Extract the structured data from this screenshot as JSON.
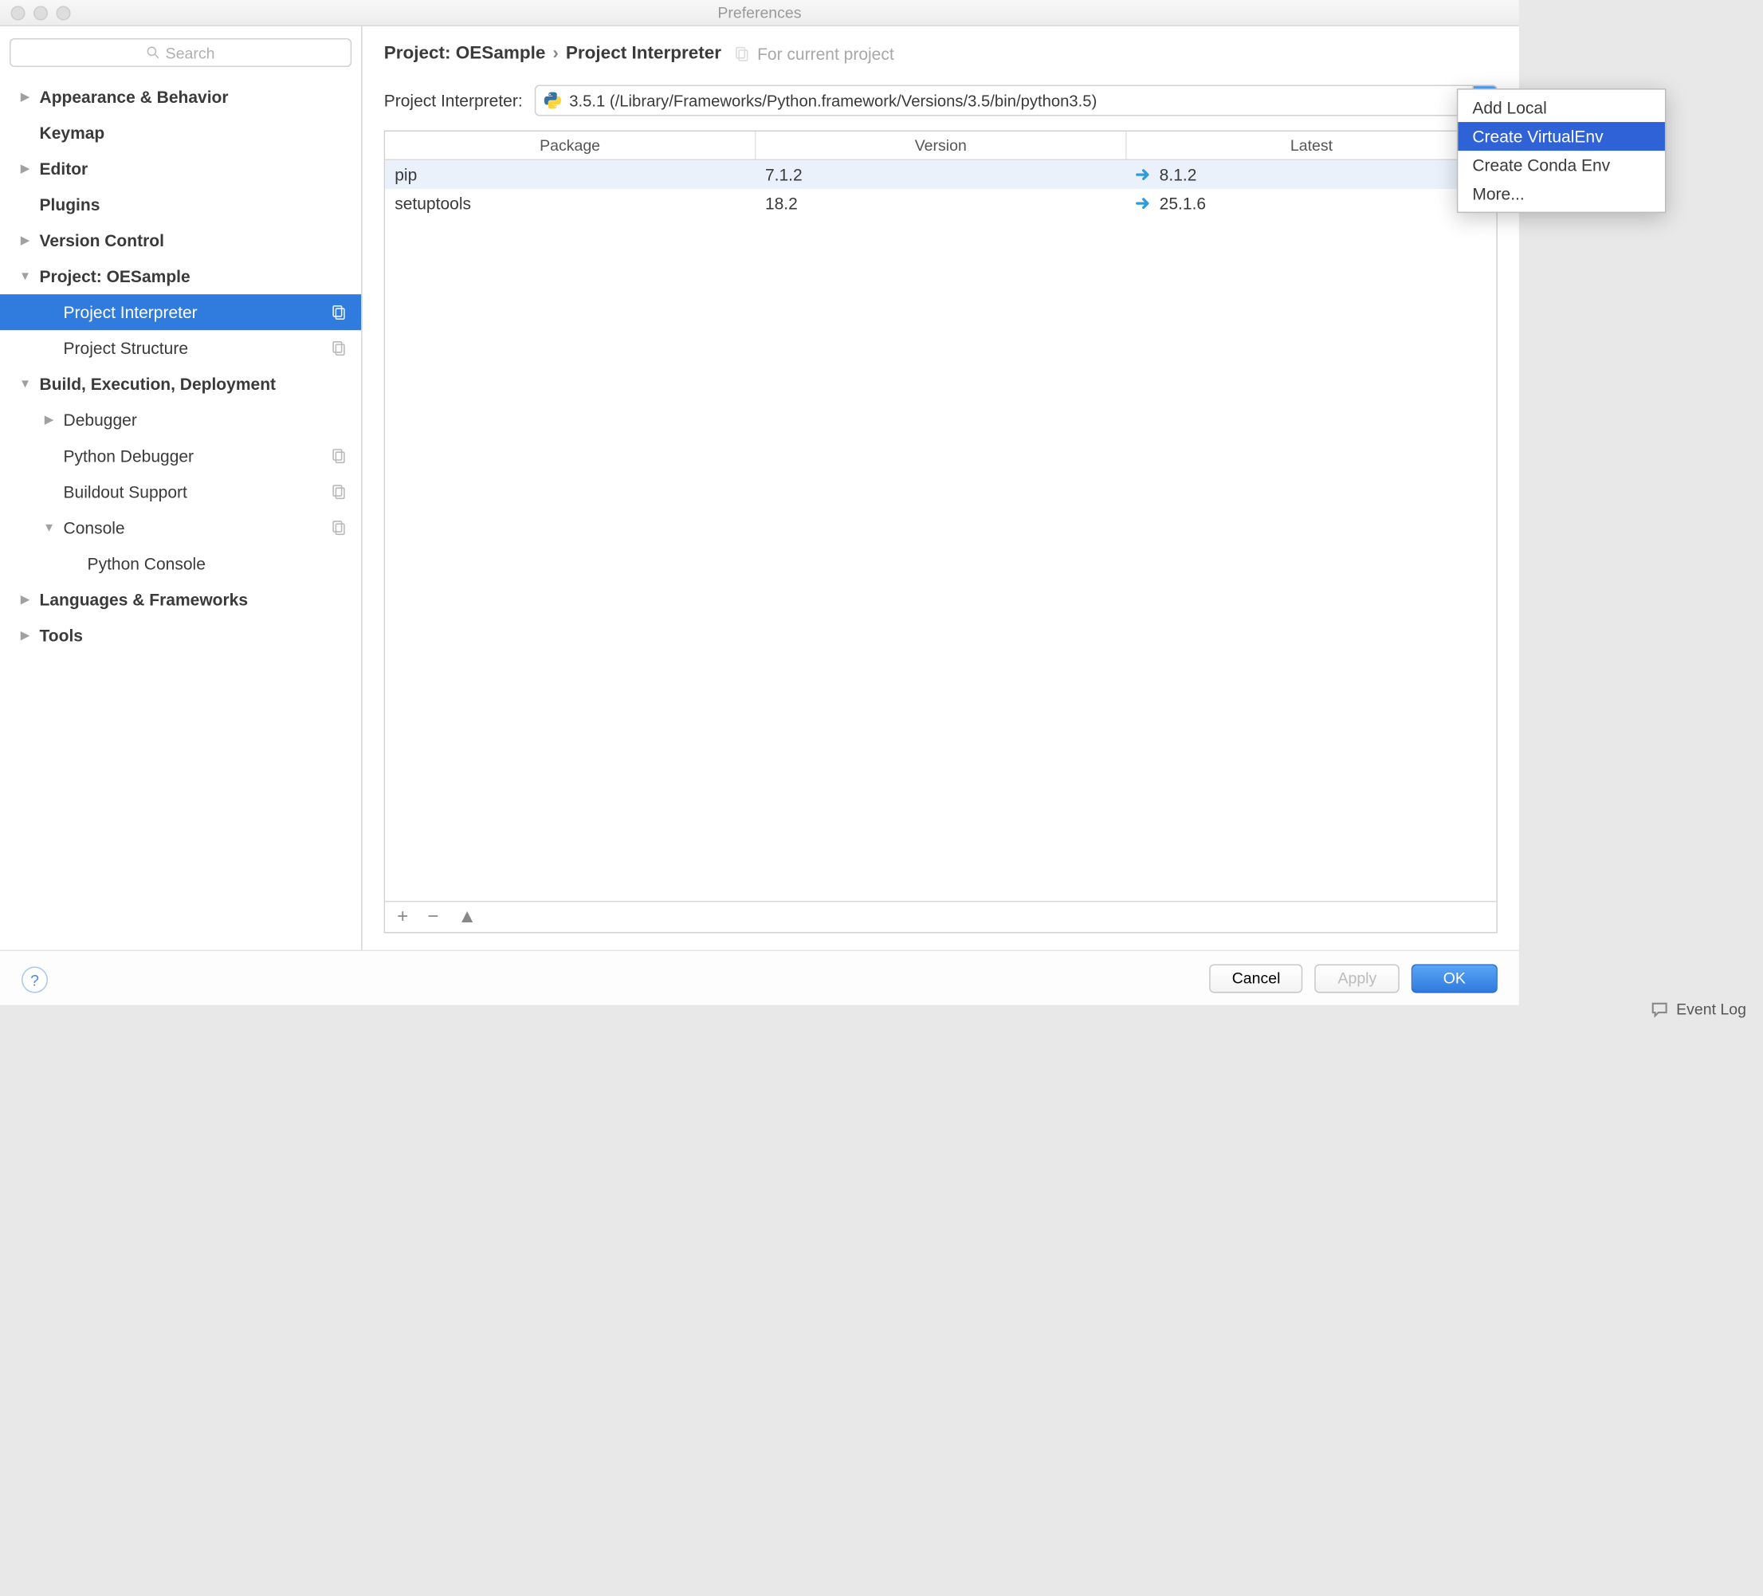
{
  "window": {
    "title": "Preferences"
  },
  "search": {
    "placeholder": "Search"
  },
  "sidebar": {
    "items": [
      {
        "label": "Appearance & Behavior",
        "level": 0,
        "bold": true,
        "arrow": "right"
      },
      {
        "label": "Keymap",
        "level": 0,
        "bold": true
      },
      {
        "label": "Editor",
        "level": 0,
        "bold": true,
        "arrow": "right"
      },
      {
        "label": "Plugins",
        "level": 0,
        "bold": true
      },
      {
        "label": "Version Control",
        "level": 0,
        "bold": true,
        "arrow": "right"
      },
      {
        "label": "Project: OESample",
        "level": 0,
        "bold": true,
        "arrow": "down"
      },
      {
        "label": "Project Interpreter",
        "level": 1,
        "selected": true,
        "badge": true
      },
      {
        "label": "Project Structure",
        "level": 1,
        "badge": true
      },
      {
        "label": "Build, Execution, Deployment",
        "level": 0,
        "bold": true,
        "arrow": "down"
      },
      {
        "label": "Debugger",
        "level": 1,
        "arrow": "right"
      },
      {
        "label": "Python Debugger",
        "level": 1,
        "badge": true
      },
      {
        "label": "Buildout Support",
        "level": 1,
        "badge": true
      },
      {
        "label": "Console",
        "level": 1,
        "arrow": "down",
        "badge": true
      },
      {
        "label": "Python Console",
        "level": 2
      },
      {
        "label": "Languages & Frameworks",
        "level": 0,
        "bold": true,
        "arrow": "right"
      },
      {
        "label": "Tools",
        "level": 0,
        "bold": true,
        "arrow": "right"
      }
    ]
  },
  "breadcrumb": {
    "part1": "Project: OESample",
    "part2": "Project Interpreter",
    "note": "For current project"
  },
  "interpreter": {
    "label": "Project Interpreter:",
    "selected": "3.5.1 (/Library/Frameworks/Python.framework/Versions/3.5/bin/python3.5)"
  },
  "table": {
    "headers": {
      "package": "Package",
      "version": "Version",
      "latest": "Latest"
    },
    "rows": [
      {
        "package": "pip",
        "version": "7.1.2",
        "latest": "8.1.2",
        "upgrade": true,
        "selected": true
      },
      {
        "package": "setuptools",
        "version": "18.2",
        "latest": "25.1.6",
        "upgrade": true
      }
    ]
  },
  "popup": {
    "items": [
      {
        "label": "Add Local"
      },
      {
        "label": "Create VirtualEnv",
        "highlighted": true
      },
      {
        "label": "Create Conda Env"
      },
      {
        "label": "More..."
      }
    ]
  },
  "buttons": {
    "cancel": "Cancel",
    "apply": "Apply",
    "ok": "OK"
  },
  "statusbar": {
    "eventlog": "Event Log"
  }
}
